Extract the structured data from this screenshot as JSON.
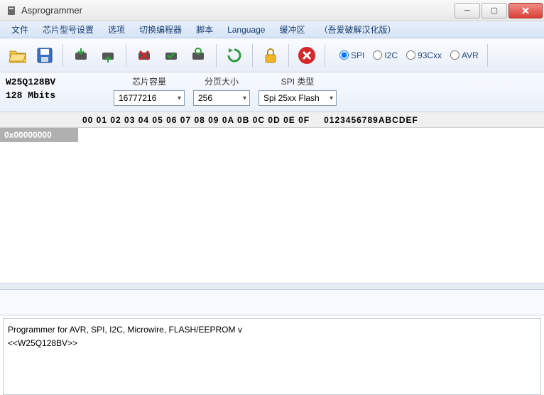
{
  "window": {
    "title": "Asprogrammer"
  },
  "menu": {
    "items": [
      "文件",
      "芯片型号设置",
      "选项",
      "切换编程器",
      "脚本",
      "Language",
      "缓冲区",
      "（吾爱破解汉化版）"
    ]
  },
  "toolbar": {
    "icons": [
      "folder-open",
      "save",
      "chip-read",
      "chip-write",
      "chip-erase",
      "chip-verify",
      "chip-blank",
      "chip-reload",
      "lock",
      "cancel"
    ]
  },
  "radio": {
    "options": [
      {
        "label": "SPI",
        "checked": true
      },
      {
        "label": "I2C",
        "checked": false
      },
      {
        "label": "93Cxx",
        "checked": false
      },
      {
        "label": "AVR",
        "checked": false
      }
    ]
  },
  "chip": {
    "name": "W25Q128BV",
    "size": "128 Mbits"
  },
  "config": {
    "capacity_label": "芯片容量",
    "capacity_value": "16777216",
    "pagesize_label": "分页大小",
    "pagesize_value": "256",
    "spitype_label": "SPI 类型",
    "spitype_value": "Spi 25xx Flash"
  },
  "hex": {
    "columns": "00 01 02 03 04 05 06 07 08 09 0A 0B 0C 0D 0E 0F",
    "ascii_header": "0123456789ABCDEF",
    "rows": [
      {
        "offset": "0x00000000"
      }
    ]
  },
  "log": {
    "lines": [
      "Programmer for AVR, SPI, I2C, Microwire, FLASH/EEPROM v",
      "<<W25Q128BV>>"
    ]
  }
}
